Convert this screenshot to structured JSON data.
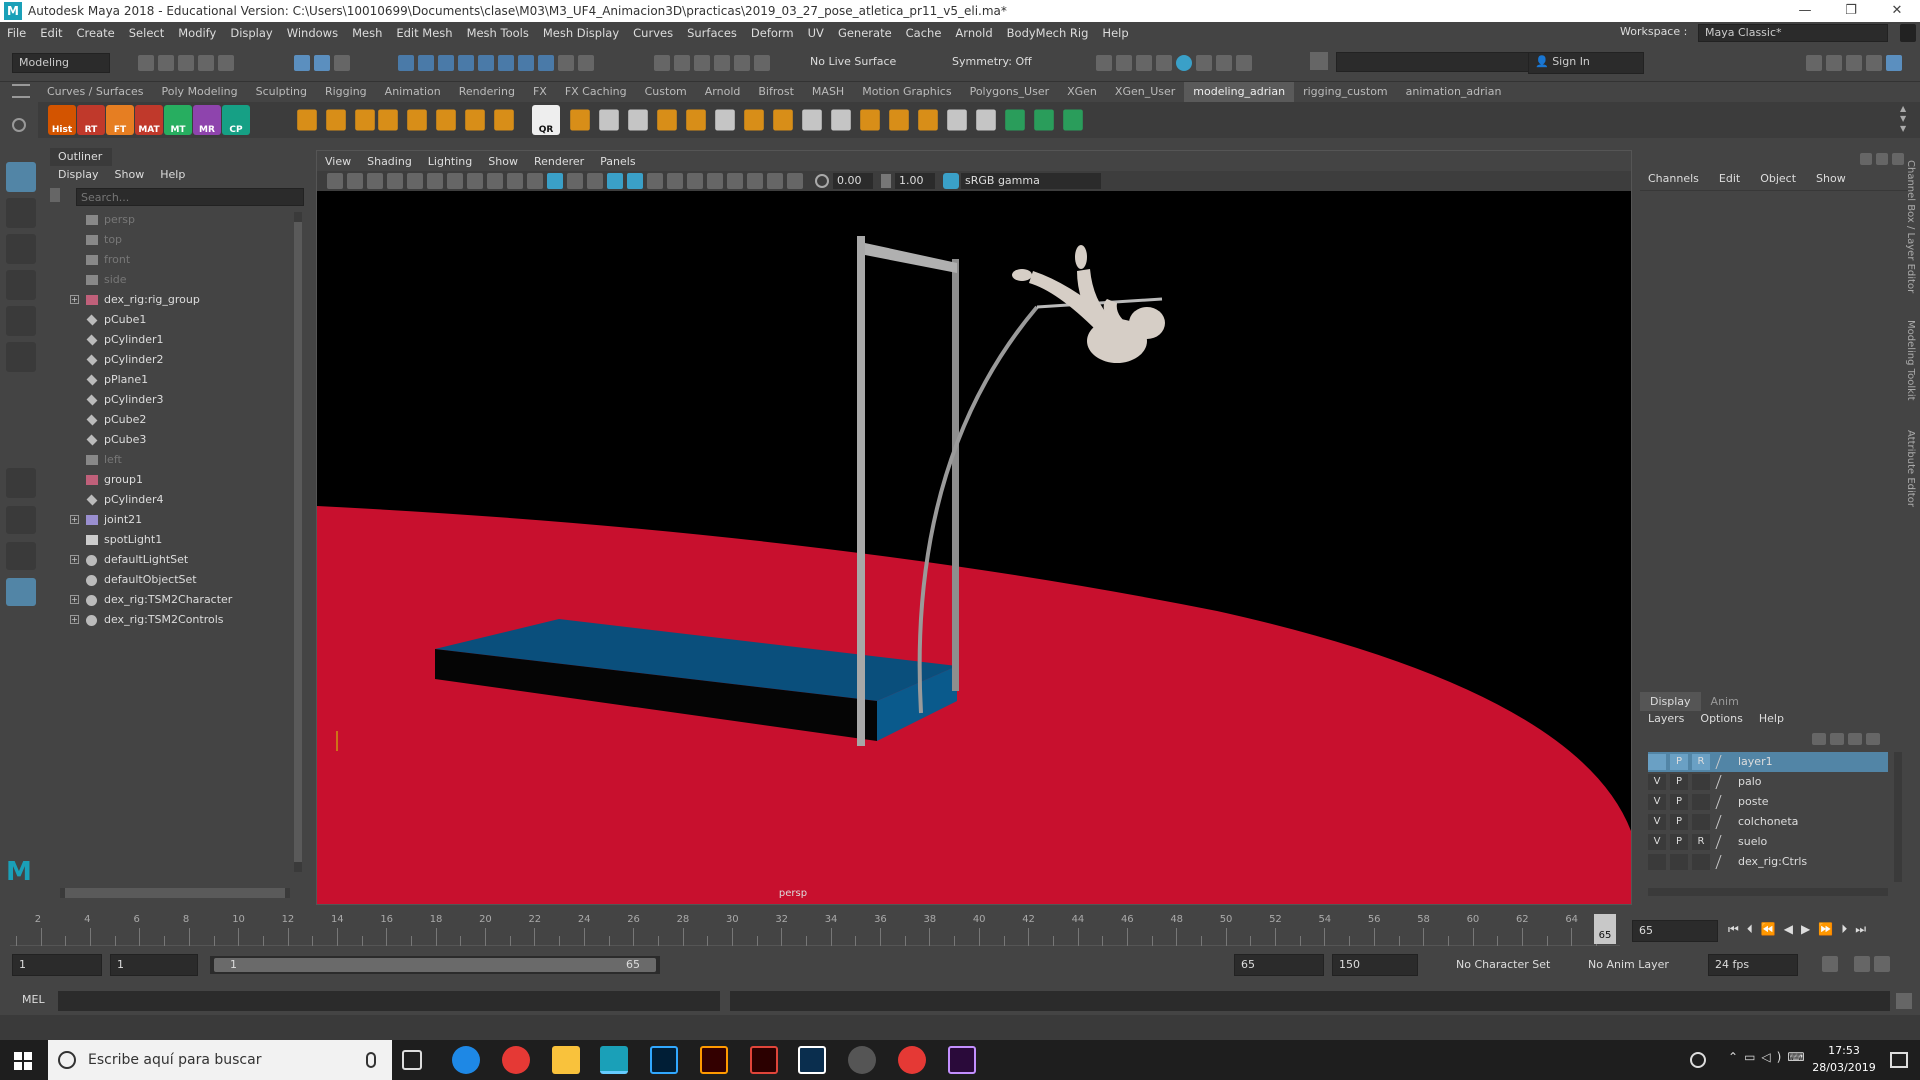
{
  "window": {
    "title": "Autodesk Maya 2018 - Educational Version: C:\\Users\\10010699\\Documents\\clase\\M03\\M3_UF4_Animacion3D\\practicas\\2019_03_27_pose_atletica_pr11_v5_eli.ma*",
    "workspace_label": "Workspace :",
    "workspace_value": "Maya Classic*"
  },
  "menus": [
    "File",
    "Edit",
    "Create",
    "Select",
    "Modify",
    "Display",
    "Windows",
    "Mesh",
    "Edit Mesh",
    "Mesh Tools",
    "Mesh Display",
    "Curves",
    "Surfaces",
    "Deform",
    "UV",
    "Generate",
    "Cache",
    "Arnold",
    "BodyMech Rig",
    "Help"
  ],
  "statusline": {
    "menuset": "Modeling",
    "live_surface": "No Live Surface",
    "symmetry": "Symmetry: Off",
    "sign_in": "Sign In"
  },
  "shelf_tabs": [
    "Curves / Surfaces",
    "Poly Modeling",
    "Sculpting",
    "Rigging",
    "Animation",
    "Rendering",
    "FX",
    "FX Caching",
    "Custom",
    "Arnold",
    "Bifrost",
    "MASH",
    "Motion Graphics",
    "Polygons_User",
    "XGen",
    "XGen_User",
    "modeling_adrian",
    "rigging_custom",
    "animation_adrian"
  ],
  "shelf_active": "modeling_adrian",
  "shelf_labels": [
    "Hist",
    "RT",
    "FT",
    "MAT",
    "MT",
    "MR",
    "CP",
    "QR"
  ],
  "outliner": {
    "title": "Outliner",
    "menu": [
      "Display",
      "Show",
      "Help"
    ],
    "search_placeholder": "Search...",
    "items": [
      {
        "label": "persp",
        "type": "camera",
        "dim": true,
        "expandable": false
      },
      {
        "label": "top",
        "type": "camera",
        "dim": true,
        "expandable": false
      },
      {
        "label": "front",
        "type": "camera",
        "dim": true,
        "expandable": false
      },
      {
        "label": "side",
        "type": "camera",
        "dim": true,
        "expandable": false
      },
      {
        "label": "dex_rig:rig_group",
        "type": "group",
        "dim": false,
        "expandable": true
      },
      {
        "label": "pCube1",
        "type": "mesh",
        "dim": false,
        "expandable": false
      },
      {
        "label": "pCylinder1",
        "type": "mesh",
        "dim": false,
        "expandable": false
      },
      {
        "label": "pCylinder2",
        "type": "mesh",
        "dim": false,
        "expandable": false
      },
      {
        "label": "pPlane1",
        "type": "mesh",
        "dim": false,
        "expandable": false
      },
      {
        "label": "pCylinder3",
        "type": "mesh",
        "dim": false,
        "expandable": false
      },
      {
        "label": "pCube2",
        "type": "mesh",
        "dim": false,
        "expandable": false
      },
      {
        "label": "pCube3",
        "type": "mesh",
        "dim": false,
        "expandable": false
      },
      {
        "label": "left",
        "type": "camera",
        "dim": true,
        "expandable": false
      },
      {
        "label": "group1",
        "type": "group",
        "dim": false,
        "expandable": false
      },
      {
        "label": "pCylinder4",
        "type": "mesh",
        "dim": false,
        "expandable": false
      },
      {
        "label": "joint21",
        "type": "joint",
        "dim": false,
        "expandable": true
      },
      {
        "label": "spotLight1",
        "type": "light",
        "dim": false,
        "expandable": false
      },
      {
        "label": "defaultLightSet",
        "type": "set",
        "dim": false,
        "expandable": true
      },
      {
        "label": "defaultObjectSet",
        "type": "set",
        "dim": false,
        "expandable": false
      },
      {
        "label": "dex_rig:TSM2Character",
        "type": "set",
        "dim": false,
        "expandable": true
      },
      {
        "label": "dex_rig:TSM2Controls",
        "type": "set",
        "dim": false,
        "expandable": true
      }
    ]
  },
  "viewport": {
    "menu": [
      "View",
      "Shading",
      "Lighting",
      "Show",
      "Renderer",
      "Panels"
    ],
    "exposure": "0.00",
    "gamma": "1.00",
    "color_space": "sRGB gamma",
    "camera_label": "persp",
    "colors": {
      "floor": "#c8102e",
      "mat": "#0a5a8c",
      "bar": "#9a9a9a",
      "figure": "#d8d0c8",
      "background": "#000000"
    }
  },
  "channelbox": {
    "menu": [
      "Channels",
      "Edit",
      "Object",
      "Show"
    ],
    "side_tabs": [
      "Channel Box / Layer Editor",
      "Modeling Toolkit",
      "Attribute Editor"
    ]
  },
  "layers": {
    "tabs": [
      "Display",
      "Anim"
    ],
    "active_tab": "Display",
    "menu": [
      "Layers",
      "Options",
      "Help"
    ],
    "rows": [
      {
        "v": "",
        "p": "P",
        "r": "R",
        "name": "layer1",
        "selected": true
      },
      {
        "v": "V",
        "p": "P",
        "r": "",
        "name": "palo",
        "selected": false
      },
      {
        "v": "V",
        "p": "P",
        "r": "",
        "name": "poste",
        "selected": false
      },
      {
        "v": "V",
        "p": "P",
        "r": "",
        "name": "colchoneta",
        "selected": false
      },
      {
        "v": "V",
        "p": "P",
        "r": "R",
        "name": "suelo",
        "selected": false
      },
      {
        "v": "",
        "p": "",
        "r": "",
        "name": "dex_rig:Ctrls",
        "selected": false
      }
    ]
  },
  "timeline": {
    "ticks": [
      "2",
      "4",
      "6",
      "8",
      "10",
      "12",
      "14",
      "16",
      "18",
      "20",
      "22",
      "24",
      "26",
      "28",
      "30",
      "32",
      "34",
      "36",
      "38",
      "40",
      "42",
      "44",
      "46",
      "48",
      "50",
      "52",
      "54",
      "56",
      "58",
      "60",
      "62",
      "64"
    ],
    "current_frame": "65",
    "current_frame_field": "65"
  },
  "range": {
    "start": "1",
    "anim_start": "1",
    "slider_start": "1",
    "slider_end": "65",
    "anim_end": "65",
    "end": "150",
    "character_set": "No Character Set",
    "anim_layer": "No Anim Layer",
    "fps": "24 fps"
  },
  "cmdline": {
    "label": "MEL"
  },
  "taskbar": {
    "search_placeholder": "Escribe aquí para buscar",
    "time": "17:53",
    "date": "28/03/2019"
  }
}
